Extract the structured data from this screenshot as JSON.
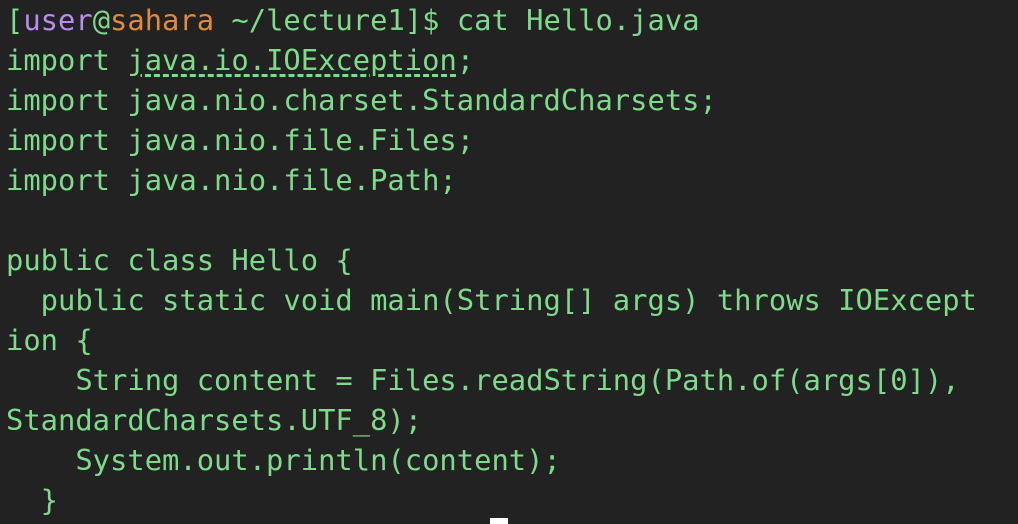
{
  "prompt": {
    "open_bracket": "[",
    "user": "user",
    "at": "@",
    "host": "sahara",
    "dir": " ~/lecture1",
    "close": "]$ ",
    "command": "cat Hello.java"
  },
  "code": {
    "l1_kw": "import ",
    "l1_pkg": "java.io.IOException",
    "l1_end": ";",
    "l2": "import java.nio.charset.StandardCharsets;",
    "l3": "import java.nio.file.Files;",
    "l4": "import java.nio.file.Path;",
    "l5": "",
    "l6": "public class Hello {",
    "l7": "  public static void main(String[] args) throws IOExcept",
    "l8": "ion {",
    "l9": "    String content = Files.readString(Path.of(args[0]),",
    "l10": "StandardCharsets.UTF_8);",
    "l11": "    System.out.println(content);",
    "l12": "  }"
  },
  "colors": {
    "background": "#222222",
    "text": "#7ddc8a",
    "user": "#b88cf0",
    "host": "#e08a3a",
    "cursor": "#ffffff"
  }
}
